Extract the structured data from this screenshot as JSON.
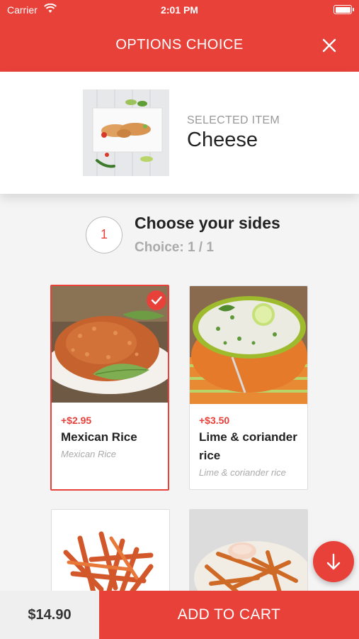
{
  "status_bar": {
    "carrier": "Carrier",
    "time": "2:01 PM"
  },
  "header": {
    "title": "OPTIONS CHOICE"
  },
  "selected_item": {
    "label": "SELECTED ITEM",
    "name": "Cheese"
  },
  "step": {
    "number": "1",
    "title": "Choose your sides",
    "choice": "Choice: 1 / 1"
  },
  "options": [
    {
      "price": "+$2.95",
      "name": "Mexican Rice",
      "desc": "Mexican Rice",
      "selected": true
    },
    {
      "price": "+$3.50",
      "name": "Lime & coriander rice",
      "desc": "Lime & coriander rice",
      "selected": false
    }
  ],
  "cart": {
    "total": "$14.90",
    "add_label": "ADD TO CART"
  },
  "colors": {
    "accent": "#e8413a"
  },
  "icons": {
    "close": "close-icon",
    "scroll_down": "arrow-down-icon",
    "check": "check-icon",
    "wifi": "wifi-icon",
    "battery": "battery-icon"
  }
}
